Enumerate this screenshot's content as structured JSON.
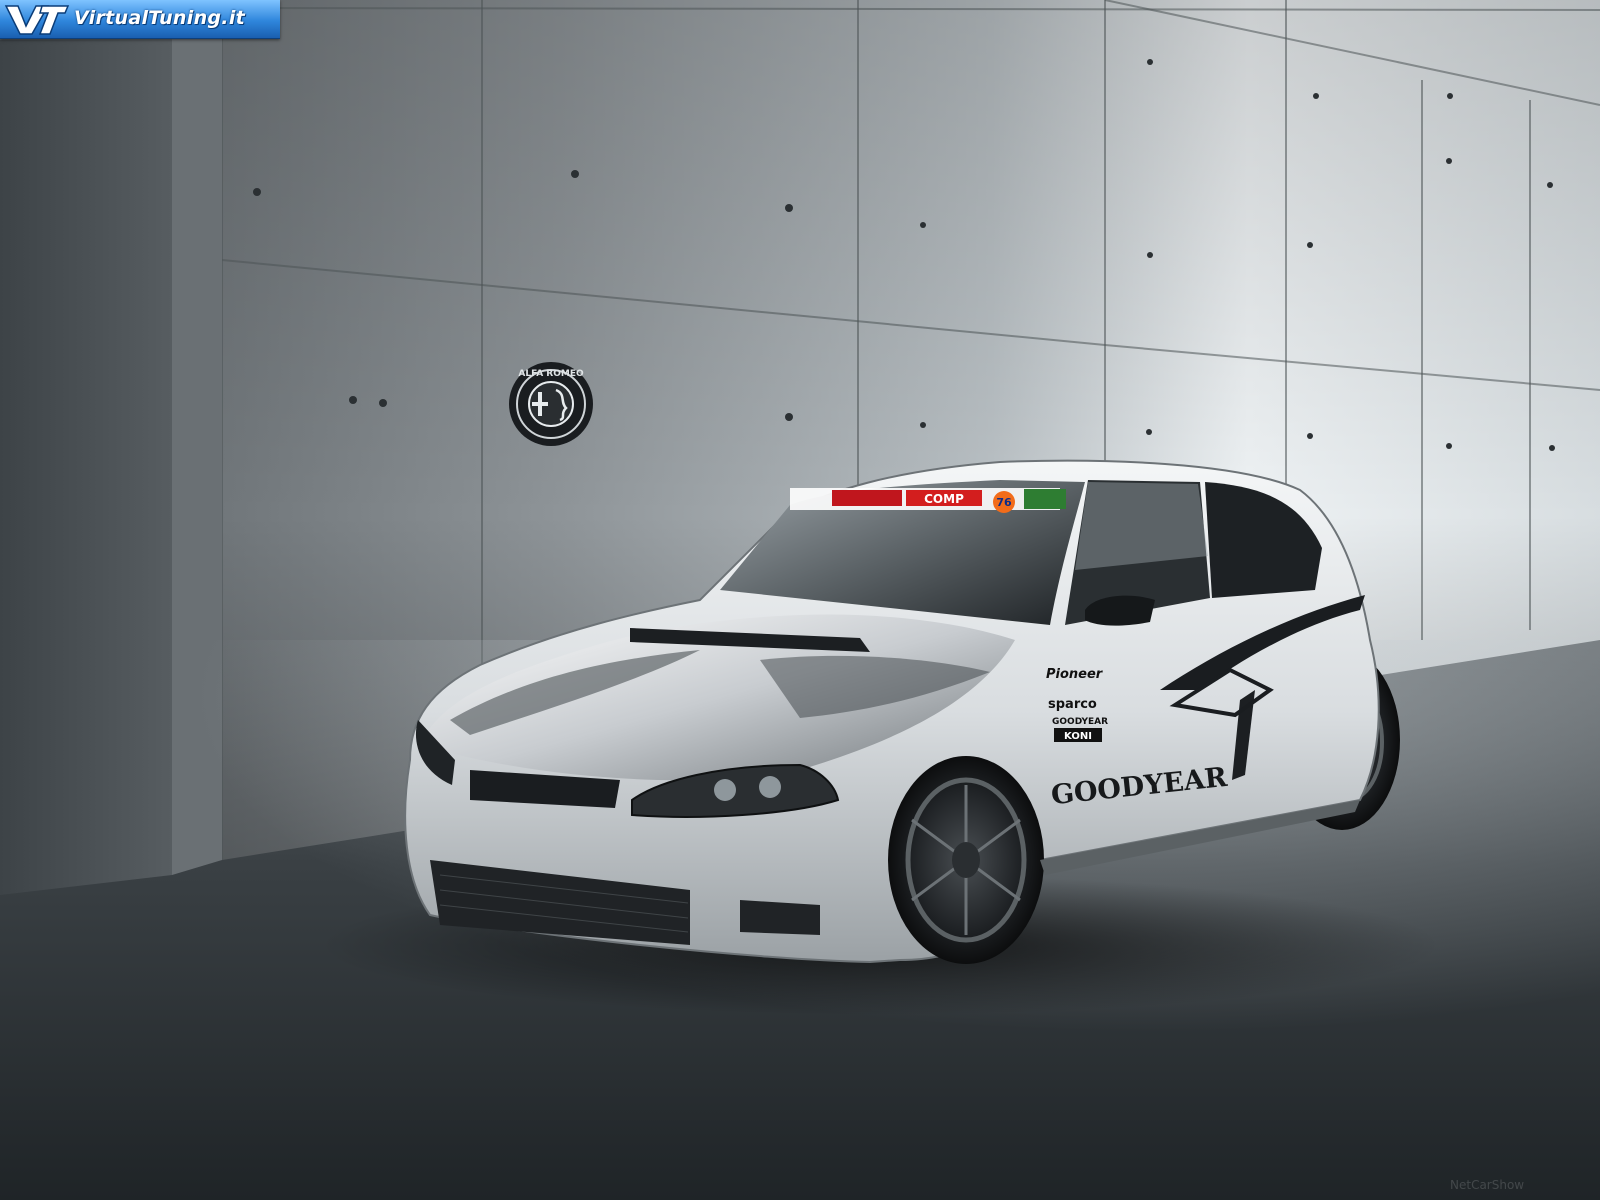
{
  "banner": {
    "site_name": "VirtualTuning.it",
    "logo_letters": "VT"
  },
  "wall_emblem": {
    "text": "ALFA ROMEO",
    "icon": "alfa-romeo-badge-icon"
  },
  "car": {
    "description_icon": "tuned-white-hatchback",
    "windshield_stickers": [
      "COMP",
      "76"
    ],
    "side_sponsors": [
      "Pioneer",
      "sparco",
      "GOODYEAR",
      "KONI"
    ],
    "door_logo": "GOODYEAR"
  },
  "watermark": {
    "text": "NetCarShow"
  },
  "colors": {
    "banner_blue": "#2f86dc",
    "car_white": "#e9ecee",
    "wall_gray": "#8d9397",
    "floor_dark": "#2a2f33"
  }
}
